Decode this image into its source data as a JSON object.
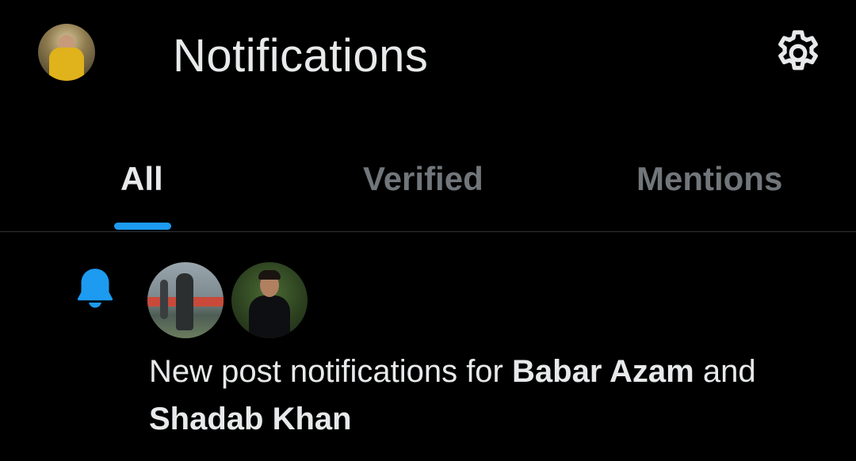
{
  "header": {
    "title": "Notifications",
    "avatar_icon": "profile-avatar",
    "settings_icon": "gear-icon"
  },
  "tabs": [
    {
      "label": "All",
      "active": true
    },
    {
      "label": "Verified",
      "active": false
    },
    {
      "label": "Mentions",
      "active": false
    }
  ],
  "notification": {
    "icon": "bell-icon",
    "text_prefix": "New post notifications for ",
    "user1": "Babar Azam",
    "connector": " and ",
    "user2": "Shadab Khan"
  },
  "colors": {
    "background": "#000000",
    "accent": "#1d9bf0",
    "text_primary": "#e7e9ea",
    "text_secondary": "#71767b",
    "divider": "#2f3336"
  }
}
